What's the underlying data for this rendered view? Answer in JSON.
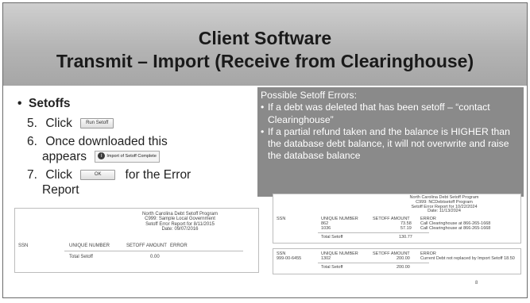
{
  "title": {
    "line1": "Client Software",
    "line2": "Transmit – Import (Receive from Clearinghouse)"
  },
  "bullets": {
    "heading": "Setoffs",
    "steps": [
      {
        "num": "5.",
        "before": "Click",
        "button": "Run Setoff",
        "after": ""
      },
      {
        "num": "6.",
        "line1": "Once downloaded this",
        "line2": "appears",
        "notification": "Import of Setoff Complete"
      },
      {
        "num": "7.",
        "before": "Click",
        "button": "OK",
        "after": "for the Error",
        "line2": "Report"
      }
    ]
  },
  "callout": {
    "heading": "Possible Setoff Errors:",
    "items": [
      "If a debt was deleted that has been setoff – “contact Clearinghouse”",
      "If a partial refund taken and the balance is HIGHER than the database debt balance, it will not overwrite and raise the database balance"
    ]
  },
  "report1": {
    "header": [
      "North Carolina Debt Setoff Program",
      "C999: Sample Local Government",
      "Setoff Error Report for 8/11/2015",
      "Date: 09/07/2016"
    ],
    "columns": [
      "SSN",
      "UNIQUE NUMBER",
      "SETOFF AMOUNT",
      "ERROR"
    ],
    "total_label": "Total Setoff",
    "total_value": "0.00"
  },
  "report2": {
    "header": [
      "North Carolina Debt Setoff Program",
      "C999: NCDebtsetoff Program",
      "Setoff Error Report for 10/22/2024",
      "Date: 11/13/2024"
    ],
    "columns": [
      "SSN",
      "UNIQUE NUMBER",
      "SETOFF AMOUNT",
      "ERROR"
    ],
    "rows": [
      {
        "unique": "862",
        "amount": "73.58",
        "error": "Call Clearinghouse at 866-265-1668"
      },
      {
        "unique": "1036",
        "amount": "57.19",
        "error": "Call Clearinghouse at 866-265-1668"
      }
    ],
    "total_label": "Total Setoff",
    "total_value": "130.77"
  },
  "report3": {
    "columns": [
      "SSN",
      "UNIQUE NUMBER",
      "SETOFF AMOUNT",
      "ERROR"
    ],
    "row": {
      "ssn": "999-00-6455",
      "unique": "1302",
      "amount": "200.00",
      "error": "Current Debt not replaced by Import Setoff  18.50"
    },
    "total_label": "Total Setoff",
    "total_value": "200.00"
  },
  "page_number": "8"
}
